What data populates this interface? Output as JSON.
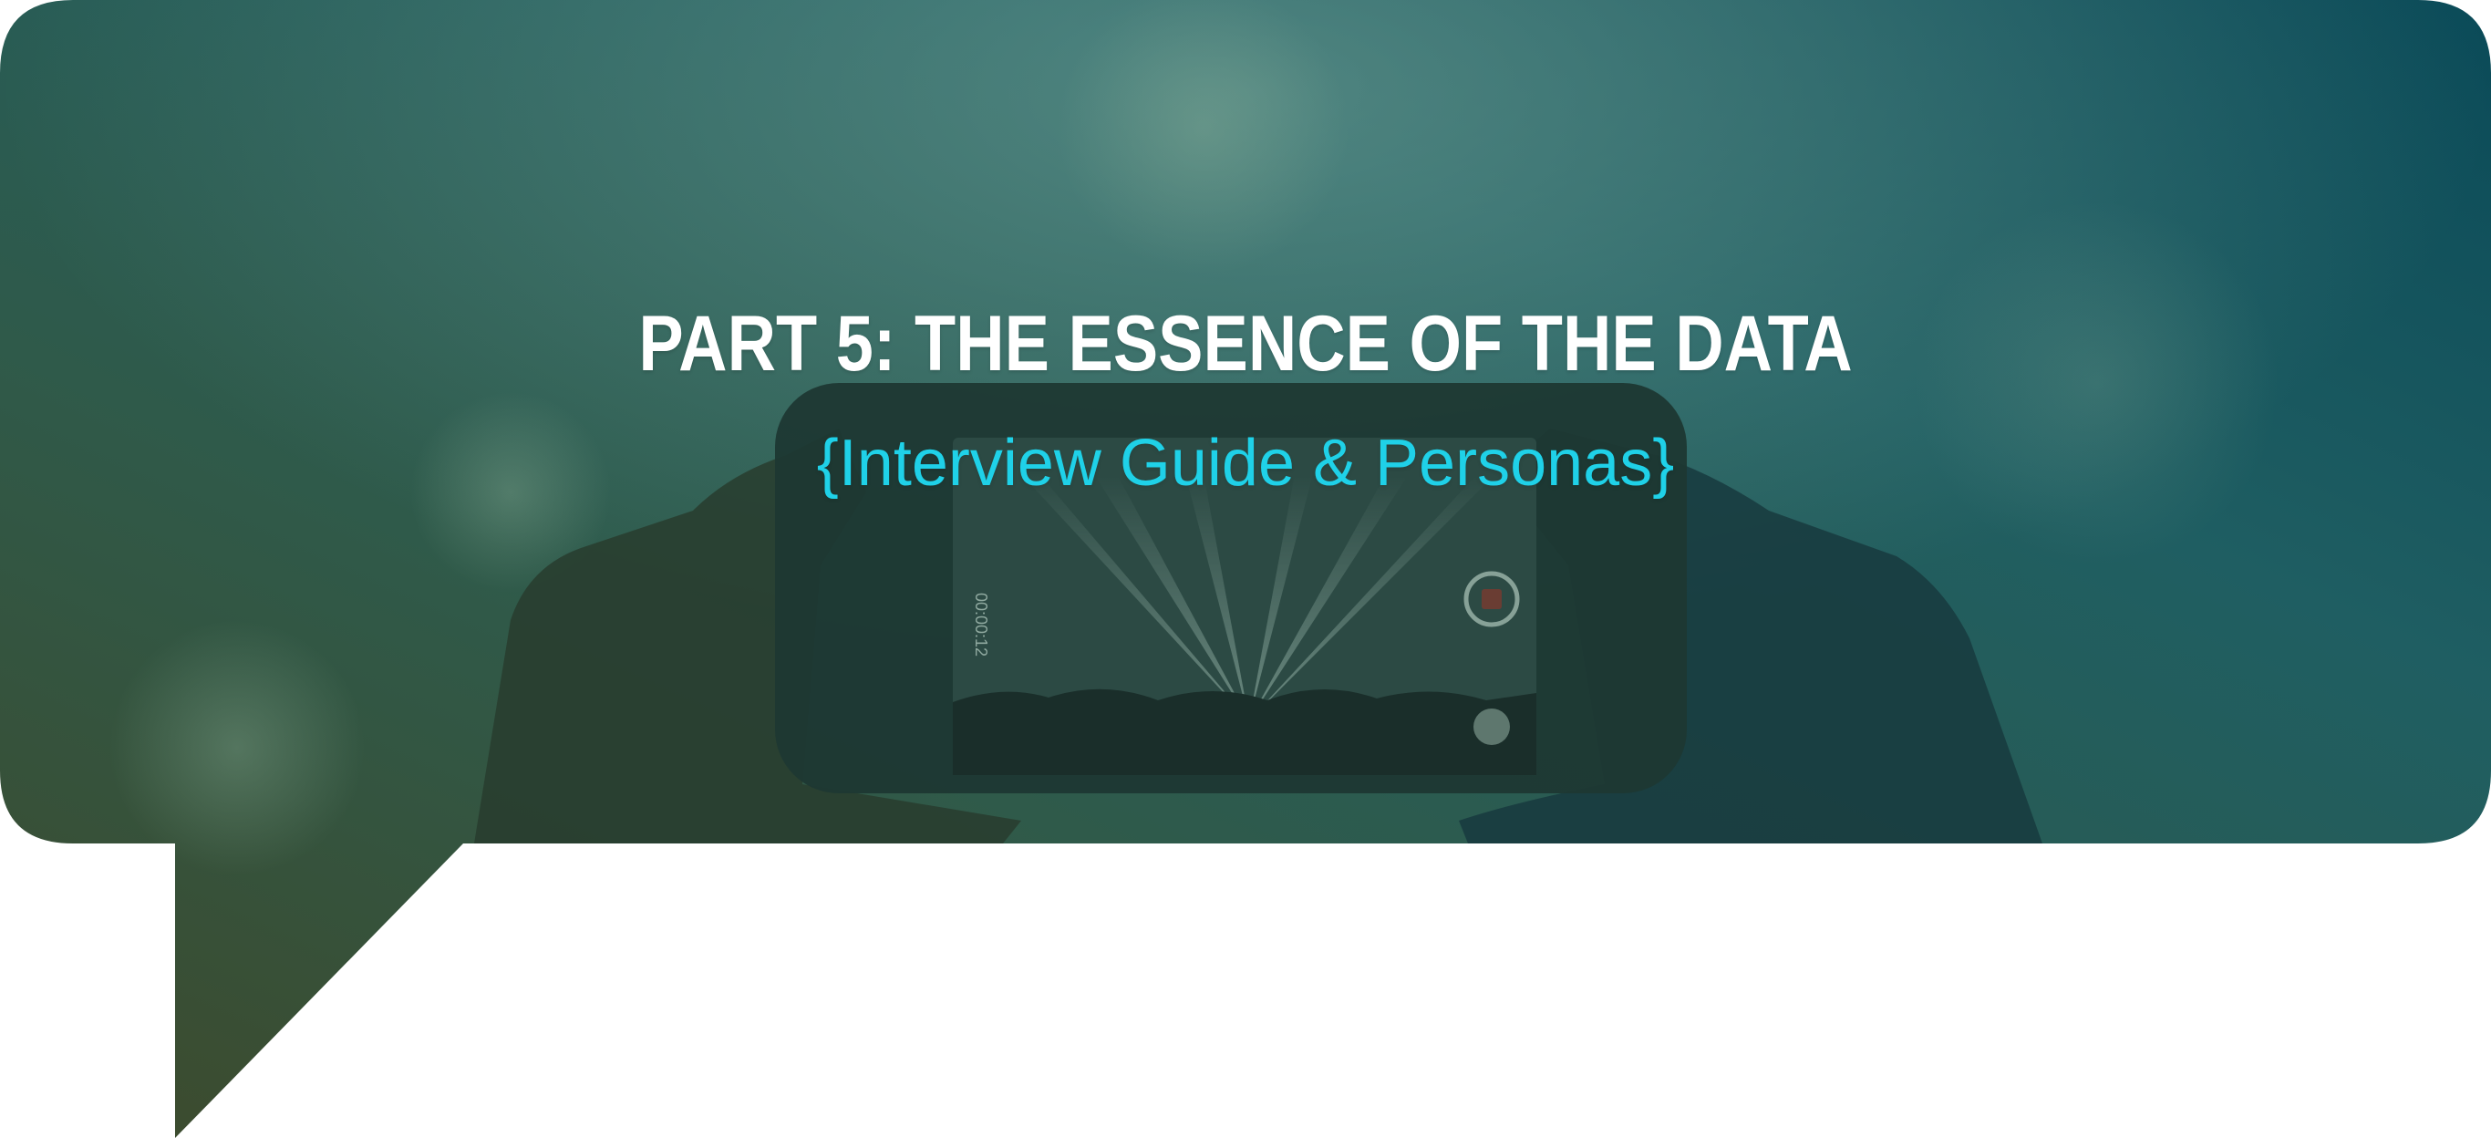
{
  "banner": {
    "title": "PART 5: THE ESSENCE OF THE DATA",
    "subtitle": "{Interview Guide & Personas}"
  },
  "colors": {
    "title": "#ffffff",
    "subtitle": "#1fd1e8",
    "overlay_left": "#3b4a2f",
    "overlay_right": "#0a4f5c",
    "background": "#ffffff"
  },
  "photo": {
    "phone_screen_timer": "00:00:12"
  }
}
